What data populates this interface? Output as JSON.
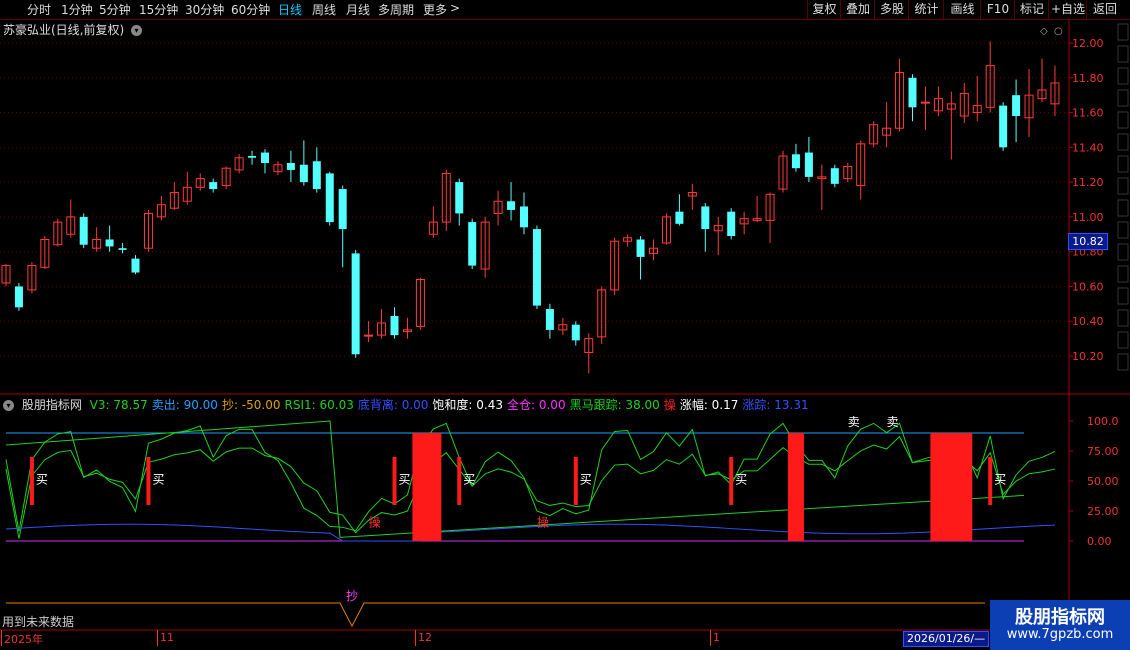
{
  "toolbar": {
    "periods": [
      "分时",
      "1分钟",
      "5分钟",
      "15分钟",
      "30分钟",
      "60分钟",
      "日线",
      "周线",
      "月线",
      "多周期",
      "更多"
    ],
    "more_arrow": ">",
    "right_buttons": [
      "复权",
      "叠加",
      "多股",
      "统计",
      "画线",
      "F10",
      "标记",
      "+自选",
      "返回"
    ]
  },
  "stock": {
    "title": "苏豪弘业(日线,前复权)",
    "current_price_tag": "10.82"
  },
  "price_axis": {
    "ticks": [
      "12.00",
      "11.80",
      "11.60",
      "11.40",
      "11.20",
      "11.00",
      "10.80",
      "10.60",
      "10.40",
      "10.20"
    ]
  },
  "indicator": {
    "name": "股朋指标网",
    "items": [
      {
        "label": "V3: 78.57",
        "color": "#20d020"
      },
      {
        "label": "卖出: 90.00",
        "color": "#20a0ff"
      },
      {
        "label": "抄: -50.00",
        "color": "#e0a000"
      },
      {
        "label": "RSI1: 60.03",
        "color": "#20d020"
      },
      {
        "label": "底背离: 0.00",
        "color": "#3050ff"
      },
      {
        "label": "饱和度: 0.43",
        "color": "#ffffff"
      },
      {
        "label": "全仓: 0.00",
        "color": "#ff30ff"
      },
      {
        "label": "黑马跟踪: 38.00",
        "color": "#20d020"
      },
      {
        "label": "操",
        "color": "#ff2020"
      },
      {
        "label": "涨幅: 0.17",
        "color": "#ffffff"
      },
      {
        "label": "涨踪: 13.31",
        "color": "#3050ff"
      }
    ],
    "axis_ticks": [
      "100.0",
      "75.00",
      "50.00",
      "25.00",
      "0.00"
    ],
    "marker_buy": "买",
    "marker_sell": "卖",
    "marker_op": "操",
    "marker_chao": "抄"
  },
  "bottom": {
    "future_note": "用到未来数据",
    "dates": [
      "2025年",
      "11",
      "12",
      "1"
    ],
    "current_date": "2026/01/26/—"
  },
  "watermark": {
    "line1": "股朋指标网",
    "line2": "www.7gpzb.com"
  },
  "colors": {
    "up": "#ff3a3a",
    "down": "#54ffff",
    "background": "#000000",
    "grid": "#5a0000"
  },
  "chart_data": {
    "type": "candlestick",
    "candles": [
      {
        "o": 10.62,
        "c": 10.72,
        "h": 10.73,
        "l": 10.6
      },
      {
        "o": 10.6,
        "c": 10.48,
        "h": 10.62,
        "l": 10.46
      },
      {
        "o": 10.58,
        "c": 10.72,
        "h": 10.74,
        "l": 10.56
      },
      {
        "o": 10.71,
        "c": 10.87,
        "h": 10.89,
        "l": 10.7
      },
      {
        "o": 10.84,
        "c": 10.97,
        "h": 10.99,
        "l": 10.83
      },
      {
        "o": 10.9,
        "c": 11.0,
        "h": 11.1,
        "l": 10.88
      },
      {
        "o": 11.0,
        "c": 10.84,
        "h": 11.02,
        "l": 10.82
      },
      {
        "o": 10.82,
        "c": 10.87,
        "h": 10.94,
        "l": 10.8
      },
      {
        "o": 10.87,
        "c": 10.83,
        "h": 10.95,
        "l": 10.8
      },
      {
        "o": 10.82,
        "c": 10.81,
        "h": 10.85,
        "l": 10.79
      },
      {
        "o": 10.76,
        "c": 10.68,
        "h": 10.78,
        "l": 10.67
      },
      {
        "o": 10.82,
        "c": 11.02,
        "h": 11.04,
        "l": 10.8
      },
      {
        "o": 11.0,
        "c": 11.07,
        "h": 11.12,
        "l": 10.98
      },
      {
        "o": 11.05,
        "c": 11.14,
        "h": 11.2,
        "l": 11.04
      },
      {
        "o": 11.09,
        "c": 11.17,
        "h": 11.26,
        "l": 11.07
      },
      {
        "o": 11.17,
        "c": 11.22,
        "h": 11.25,
        "l": 11.15
      },
      {
        "o": 11.2,
        "c": 11.16,
        "h": 11.22,
        "l": 11.14
      },
      {
        "o": 11.18,
        "c": 11.28,
        "h": 11.29,
        "l": 11.16
      },
      {
        "o": 11.27,
        "c": 11.34,
        "h": 11.36,
        "l": 11.25
      },
      {
        "o": 11.35,
        "c": 11.34,
        "h": 11.38,
        "l": 11.3
      },
      {
        "o": 11.37,
        "c": 11.31,
        "h": 11.39,
        "l": 11.25
      },
      {
        "o": 11.26,
        "c": 11.3,
        "h": 11.32,
        "l": 11.24
      },
      {
        "o": 11.31,
        "c": 11.27,
        "h": 11.38,
        "l": 11.2
      },
      {
        "o": 11.3,
        "c": 11.2,
        "h": 11.44,
        "l": 11.18
      },
      {
        "o": 11.32,
        "c": 11.16,
        "h": 11.4,
        "l": 11.14
      },
      {
        "o": 11.25,
        "c": 10.97,
        "h": 11.26,
        "l": 10.95
      },
      {
        "o": 11.16,
        "c": 10.93,
        "h": 11.18,
        "l": 10.71
      },
      {
        "o": 10.79,
        "c": 10.21,
        "h": 10.81,
        "l": 10.19
      },
      {
        "o": 10.32,
        "c": 10.32,
        "h": 10.4,
        "l": 10.28
      },
      {
        "o": 10.32,
        "c": 10.39,
        "h": 10.47,
        "l": 10.3
      },
      {
        "o": 10.43,
        "c": 10.32,
        "h": 10.48,
        "l": 10.3
      },
      {
        "o": 10.34,
        "c": 10.35,
        "h": 10.42,
        "l": 10.3
      },
      {
        "o": 10.37,
        "c": 10.64,
        "h": 10.65,
        "l": 10.35
      },
      {
        "o": 10.9,
        "c": 10.97,
        "h": 11.06,
        "l": 10.88
      },
      {
        "o": 10.97,
        "c": 11.25,
        "h": 11.27,
        "l": 10.92
      },
      {
        "o": 11.2,
        "c": 11.02,
        "h": 11.22,
        "l": 10.95
      },
      {
        "o": 10.97,
        "c": 10.72,
        "h": 10.99,
        "l": 10.7
      },
      {
        "o": 10.7,
        "c": 10.97,
        "h": 11.0,
        "l": 10.65
      },
      {
        "o": 11.02,
        "c": 11.09,
        "h": 11.15,
        "l": 10.95
      },
      {
        "o": 11.09,
        "c": 11.04,
        "h": 11.2,
        "l": 10.98
      },
      {
        "o": 11.06,
        "c": 10.94,
        "h": 11.14,
        "l": 10.9
      },
      {
        "o": 10.93,
        "c": 10.49,
        "h": 10.95,
        "l": 10.47
      },
      {
        "o": 10.47,
        "c": 10.35,
        "h": 10.5,
        "l": 10.3
      },
      {
        "o": 10.35,
        "c": 10.38,
        "h": 10.42,
        "l": 10.32
      },
      {
        "o": 10.38,
        "c": 10.29,
        "h": 10.4,
        "l": 10.26
      },
      {
        "o": 10.22,
        "c": 10.3,
        "h": 10.33,
        "l": 10.1
      },
      {
        "o": 10.31,
        "c": 10.58,
        "h": 10.6,
        "l": 10.27
      },
      {
        "o": 10.58,
        "c": 10.86,
        "h": 10.88,
        "l": 10.55
      },
      {
        "o": 10.86,
        "c": 10.88,
        "h": 10.9,
        "l": 10.83
      },
      {
        "o": 10.87,
        "c": 10.77,
        "h": 10.89,
        "l": 10.64
      },
      {
        "o": 10.79,
        "c": 10.82,
        "h": 10.87,
        "l": 10.75
      },
      {
        "o": 10.85,
        "c": 11.0,
        "h": 11.02,
        "l": 10.84
      },
      {
        "o": 11.03,
        "c": 10.96,
        "h": 11.13,
        "l": 10.95
      },
      {
        "o": 11.12,
        "c": 11.14,
        "h": 11.19,
        "l": 11.04
      },
      {
        "o": 11.06,
        "c": 10.93,
        "h": 11.08,
        "l": 10.8
      },
      {
        "o": 10.92,
        "c": 10.95,
        "h": 11.0,
        "l": 10.78
      },
      {
        "o": 11.03,
        "c": 10.89,
        "h": 11.05,
        "l": 10.87
      },
      {
        "o": 10.96,
        "c": 10.99,
        "h": 11.03,
        "l": 10.9
      },
      {
        "o": 10.98,
        "c": 10.99,
        "h": 11.12,
        "l": 10.97
      },
      {
        "o": 10.98,
        "c": 11.13,
        "h": 11.14,
        "l": 10.85
      },
      {
        "o": 11.16,
        "c": 11.35,
        "h": 11.38,
        "l": 11.14
      },
      {
        "o": 11.36,
        "c": 11.28,
        "h": 11.42,
        "l": 11.26
      },
      {
        "o": 11.37,
        "c": 11.23,
        "h": 11.46,
        "l": 11.2
      },
      {
        "o": 11.22,
        "c": 11.23,
        "h": 11.3,
        "l": 11.04
      },
      {
        "o": 11.28,
        "c": 11.19,
        "h": 11.3,
        "l": 11.17
      },
      {
        "o": 11.22,
        "c": 11.29,
        "h": 11.31,
        "l": 11.2
      },
      {
        "o": 11.18,
        "c": 11.42,
        "h": 11.44,
        "l": 11.1
      },
      {
        "o": 11.42,
        "c": 11.53,
        "h": 11.55,
        "l": 11.4
      },
      {
        "o": 11.47,
        "c": 11.51,
        "h": 11.66,
        "l": 11.4
      },
      {
        "o": 11.51,
        "c": 11.83,
        "h": 11.91,
        "l": 11.49
      },
      {
        "o": 11.8,
        "c": 11.63,
        "h": 11.82,
        "l": 11.55
      },
      {
        "o": 11.66,
        "c": 11.66,
        "h": 11.75,
        "l": 11.5
      },
      {
        "o": 11.61,
        "c": 11.68,
        "h": 11.75,
        "l": 11.58
      },
      {
        "o": 11.62,
        "c": 11.65,
        "h": 11.72,
        "l": 11.33
      },
      {
        "o": 11.58,
        "c": 11.71,
        "h": 11.77,
        "l": 11.54
      },
      {
        "o": 11.6,
        "c": 11.64,
        "h": 11.81,
        "l": 11.55
      },
      {
        "o": 11.63,
        "c": 11.87,
        "h": 12.01,
        "l": 11.6
      },
      {
        "o": 11.64,
        "c": 11.4,
        "h": 11.66,
        "l": 11.38
      },
      {
        "o": 11.7,
        "c": 11.58,
        "h": 11.79,
        "l": 11.43
      },
      {
        "o": 11.57,
        "c": 11.7,
        "h": 11.85,
        "l": 11.46
      },
      {
        "o": 11.68,
        "c": 11.73,
        "h": 11.91,
        "l": 11.66
      },
      {
        "o": 11.65,
        "c": 11.77,
        "h": 11.87,
        "l": 11.58
      }
    ],
    "indicator": {
      "sell_line": 90,
      "buy_signals": [
        2,
        11,
        30,
        35,
        44,
        56,
        76
      ],
      "sell_blocks": [
        [
          32,
          33
        ],
        [
          61,
          61
        ],
        [
          72,
          74
        ]
      ],
      "op_markers": [
        28,
        41
      ],
      "sell_text_at": [
        65,
        68
      ]
    }
  }
}
